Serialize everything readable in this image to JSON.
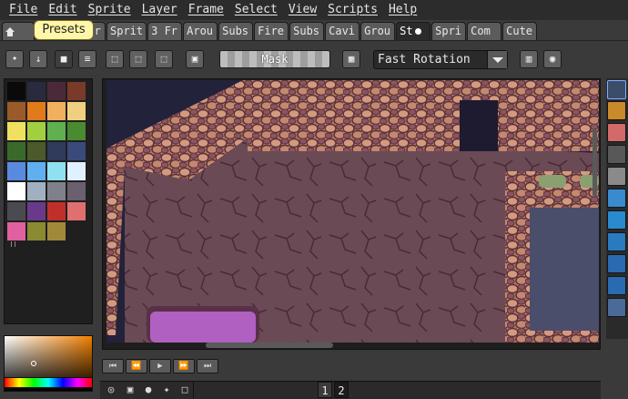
{
  "menu": [
    "File",
    "Edit",
    "Sprite",
    "Layer",
    "Frame",
    "Select",
    "View",
    "Scripts",
    "Help"
  ],
  "tabs": [
    {
      "label": "",
      "icon": "home-icon"
    },
    {
      "label": "urc"
    },
    {
      "label": "3 Fr"
    },
    {
      "label": "Sprit"
    },
    {
      "label": "3 Fr"
    },
    {
      "label": "Arou"
    },
    {
      "label": "Subs"
    },
    {
      "label": "Fire"
    },
    {
      "label": "Subs"
    },
    {
      "label": "Cavi"
    },
    {
      "label": "Grou"
    },
    {
      "label": "St",
      "active": true,
      "modified": true
    },
    {
      "label": "Spri"
    },
    {
      "label": "Com"
    },
    {
      "label": "Cute"
    }
  ],
  "tooltip": "Presets",
  "toolbar": {
    "mask_label": "Mask",
    "rotation_algorithm": "Fast Rotation"
  },
  "palette": {
    "colors": [
      "#0a0a0a",
      "#2a2a3e",
      "#4a2a3a",
      "#7a3a2a",
      "#9a5a2a",
      "#e07a1a",
      "#f0b060",
      "#f0d080",
      "#f0e060",
      "#a0d040",
      "#60b050",
      "#4a8a30",
      "#3a6a2a",
      "#4a5a2a",
      "#303a5a",
      "#3a4a7a",
      "#5a8ae0",
      "#60b0f0",
      "#90e0f0",
      "#e0f0ff",
      "#ffffff",
      "#a0b0c0",
      "#80808a",
      "#6a6070",
      "#4a4a50",
      "#6a3a8a",
      "#c0302a",
      "#e07070",
      "#e060a0",
      "#8a8a30",
      "#a08a3a"
    ]
  },
  "frames": {
    "numbers": [
      "1",
      "2"
    ],
    "current": "2"
  },
  "accent_color": "#7fb1ff"
}
